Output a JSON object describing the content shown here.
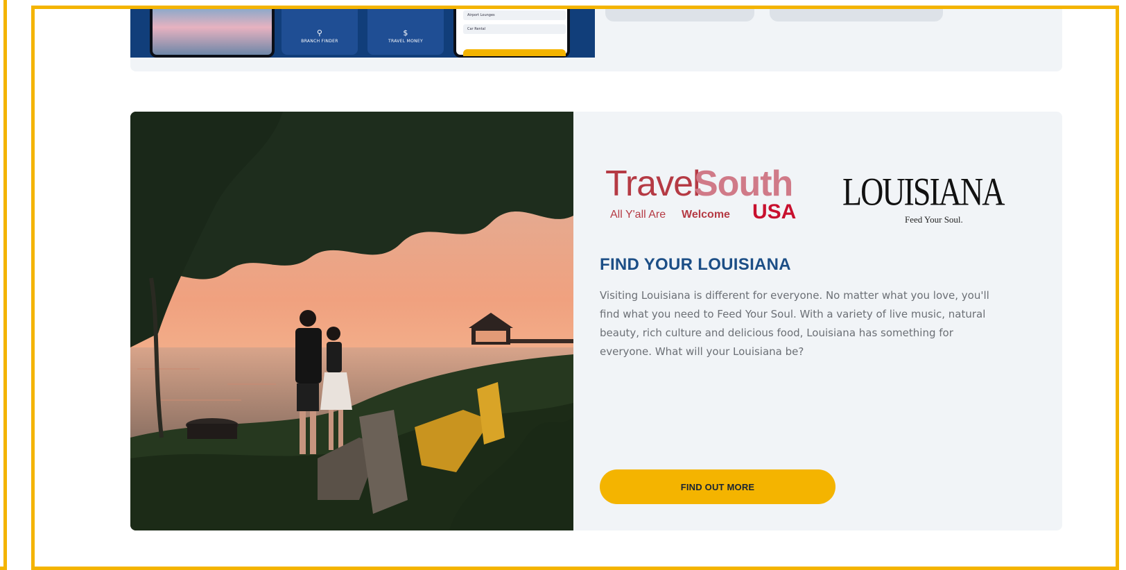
{
  "colors": {
    "frame": "#F4B400",
    "card_background": "#F1F4F7",
    "headline": "#1C4E86",
    "cta": "#F4B400",
    "brand_red": "#B53A44"
  },
  "top_card": {
    "tiles": [
      {
        "label": "BRANCH FINDER",
        "icon": "location-pin-icon"
      },
      {
        "label": "TRAVEL MONEY",
        "icon": "currency-icon"
      }
    ],
    "rows": [
      "Airport Lounges",
      "Car Rental"
    ]
  },
  "promo": {
    "image_alt": "Couple watching sunset by the lake with Adirondack chairs and a gazebo pier",
    "logo_travelsouth": {
      "travel": "Travel",
      "south": "South",
      "tagline_prefix": "All Y'all Are",
      "tagline_bold": "Welcome",
      "usa": "USA"
    },
    "logo_louisiana": {
      "wordmark": "LOUISIANA",
      "tagline": "Feed Your Soul."
    },
    "headline": "FIND YOUR LOUISIANA",
    "body": "Visiting Louisiana is different for everyone. No matter what you love, you'll find what you need to Feed Your Soul. With a variety of live music, natural beauty, rich culture and delicious food, Louisiana has something for everyone. What will your Louisiana be?",
    "cta_label": "FIND OUT MORE"
  }
}
